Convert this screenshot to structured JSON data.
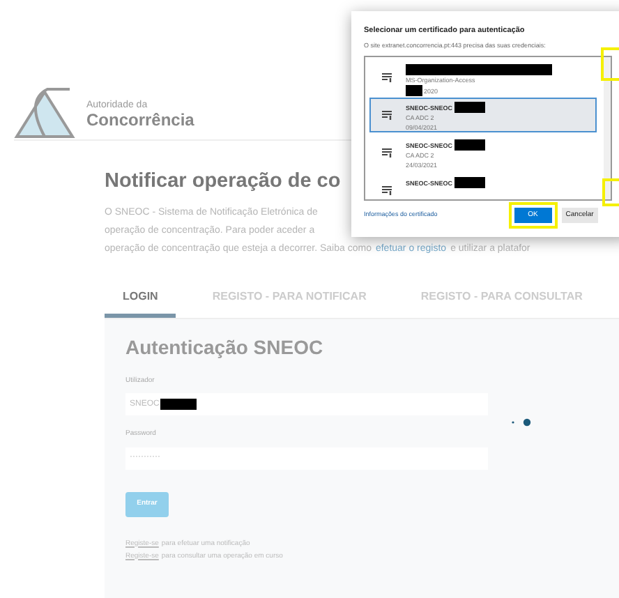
{
  "logo": {
    "tagline": "Autoridade da",
    "name": "Concorrência"
  },
  "page": {
    "title": "Notificar operação de co",
    "paragraph": [
      "O SNEOC - Sistema de Notificação Eletrónica de",
      "operação de concentração. Para poder aceder a",
      "operação de concentração que esteja a decorrer. Saiba como"
    ],
    "link": "efetuar o registo",
    "paragraph_end": "e utilizar a platafor"
  },
  "tabs": [
    {
      "label": "LOGIN",
      "selected": true
    },
    {
      "label": "REGISTO - PARA NOTIFICAR",
      "selected": false
    },
    {
      "label": "REGISTO - PARA CONSULTAR",
      "selected": false
    }
  ],
  "login": {
    "title": "Autenticação SNEOC",
    "fields": [
      {
        "label": "Utilizador",
        "value": "SNEOC",
        "redacted": true
      },
      {
        "label": "Password",
        "value": "···········",
        "redacted": false
      }
    ],
    "button": "Entrar",
    "links": [
      {
        "link": "Registe-se",
        "text": "para efetuar uma notificação"
      },
      {
        "link": "Registe-se",
        "text": "para consultar uma operação em curso"
      }
    ]
  },
  "dialog": {
    "title": "Selecionar um certificado para autenticação",
    "subtitle": "O site extranet.concorrencia.pt:443 precisa das suas credenciais:",
    "certificates": [
      {
        "issuer": "MS-Organization-Access",
        "date": "2020",
        "selected": false
      },
      {
        "name": "SNEOC-SNEOC",
        "issuer": "CA ADC 2",
        "date": "09/04/2021",
        "selected": true
      },
      {
        "name": "SNEOC-SNEOC",
        "issuer": "CA ADC 2",
        "date": "24/03/2021",
        "selected": false
      },
      {
        "name": "SNEOC-SNEOC",
        "selected": false
      }
    ],
    "info_link": "Informações do certificado",
    "ok": "OK",
    "cancel": "Cancelar"
  }
}
